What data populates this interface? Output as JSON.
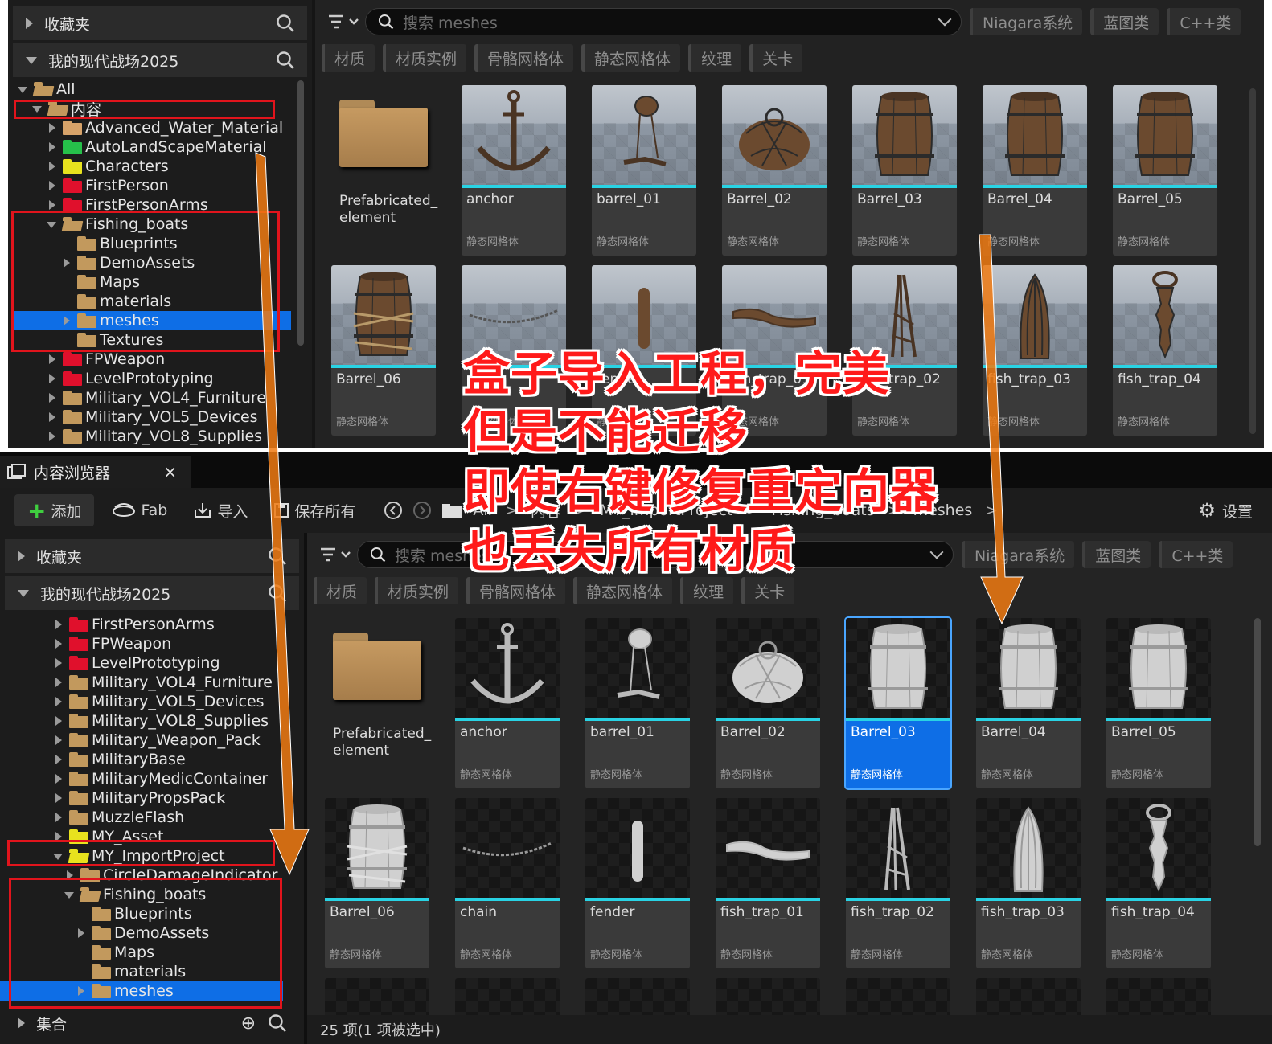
{
  "top": {
    "favorites_label": "收藏夹",
    "project_label": "我的现代战场2025",
    "tree": [
      {
        "label": "All",
        "arrow": "d",
        "color": "#c2995d",
        "indent": 0,
        "open": true
      },
      {
        "label": "内容",
        "arrow": "d",
        "color": "#c2995d",
        "indent": 1,
        "open": true
      },
      {
        "label": "Advanced_Water_Material",
        "arrow": "r",
        "color": "#d7a36a",
        "indent": 2
      },
      {
        "label": "AutoLandScapeMaterial",
        "arrow": "r",
        "color": "#26c04a",
        "indent": 2
      },
      {
        "label": "Characters",
        "arrow": "r",
        "color": "#e8e21e",
        "indent": 2
      },
      {
        "label": "FirstPerson",
        "arrow": "r",
        "color": "#e0102c",
        "indent": 2
      },
      {
        "label": "FirstPersonArms",
        "arrow": "r",
        "color": "#e0102c",
        "indent": 2
      },
      {
        "label": "Fishing_boats",
        "arrow": "d",
        "color": "#c2995d",
        "indent": 2,
        "open": true
      },
      {
        "label": "Blueprints",
        "arrow": "",
        "color": "#c2995d",
        "indent": 3
      },
      {
        "label": "DemoAssets",
        "arrow": "r",
        "color": "#c2995d",
        "indent": 3
      },
      {
        "label": "Maps",
        "arrow": "",
        "color": "#c2995d",
        "indent": 3
      },
      {
        "label": "materials",
        "arrow": "",
        "color": "#c2995d",
        "indent": 3
      },
      {
        "label": "meshes",
        "arrow": "r",
        "color": "#c2995d",
        "indent": 3,
        "selected": true
      },
      {
        "label": "Textures",
        "arrow": "",
        "color": "#c2995d",
        "indent": 3
      },
      {
        "label": "FPWeapon",
        "arrow": "r",
        "color": "#e0102c",
        "indent": 2
      },
      {
        "label": "LevelPrototyping",
        "arrow": "r",
        "color": "#e0102c",
        "indent": 2
      },
      {
        "label": "Military_VOL4_Furniture",
        "arrow": "r",
        "color": "#c2995d",
        "indent": 2
      },
      {
        "label": "Military_VOL5_Devices",
        "arrow": "r",
        "color": "#c2995d",
        "indent": 2
      },
      {
        "label": "Military_VOL8_Supplies",
        "arrow": "r",
        "color": "#c2995d",
        "indent": 2
      }
    ],
    "search_placeholder": "搜索 meshes",
    "pills": [
      "Niagara系统",
      "蓝图类",
      "C++类"
    ],
    "chips": [
      "材质",
      "材质实例",
      "骨骼网格体",
      "静态网格体",
      "纹理",
      "关卡"
    ]
  },
  "bottom": {
    "tab_title": "内容浏览器",
    "tab_close": "×",
    "toolbar": {
      "add": "添加",
      "fab": "Fab",
      "import": "导入",
      "save_all": "保存所有",
      "settings": "设置"
    },
    "breadcrumb": [
      "All",
      "内容",
      "MY_ImportProject",
      "Fishing_boats",
      "meshes"
    ],
    "favorites_label": "收藏夹",
    "project_label": "我的现代战场2025",
    "collections_label": "集合",
    "tree": [
      {
        "label": "FirstPersonArms",
        "arrow": "r",
        "color": "#e0102c",
        "indent": 2
      },
      {
        "label": "FPWeapon",
        "arrow": "r",
        "color": "#e0102c",
        "indent": 2
      },
      {
        "label": "LevelPrototyping",
        "arrow": "r",
        "color": "#e0102c",
        "indent": 2
      },
      {
        "label": "Military_VOL4_Furniture",
        "arrow": "r",
        "color": "#c2995d",
        "indent": 2
      },
      {
        "label": "Military_VOL5_Devices",
        "arrow": "r",
        "color": "#c2995d",
        "indent": 2
      },
      {
        "label": "Military_VOL8_Supplies",
        "arrow": "r",
        "color": "#c2995d",
        "indent": 2
      },
      {
        "label": "Military_Weapon_Pack",
        "arrow": "r",
        "color": "#c2995d",
        "indent": 2
      },
      {
        "label": "MilitaryBase",
        "arrow": "r",
        "color": "#c2995d",
        "indent": 2
      },
      {
        "label": "MilitaryMedicContainer",
        "arrow": "r",
        "color": "#c2995d",
        "indent": 2
      },
      {
        "label": "MilitaryPropsPack",
        "arrow": "r",
        "color": "#c2995d",
        "indent": 2
      },
      {
        "label": "MuzzleFlash",
        "arrow": "r",
        "color": "#c2995d",
        "indent": 2
      },
      {
        "label": "MY_Asset",
        "arrow": "r",
        "color": "#e8e21e",
        "indent": 2
      },
      {
        "label": "MY_ImportProject",
        "arrow": "d",
        "color": "#e8e21e",
        "indent": 2,
        "open": true
      },
      {
        "label": "CircleDamageIndicator",
        "arrow": "r",
        "color": "#c2995d",
        "indent": 3
      },
      {
        "label": "Fishing_boats",
        "arrow": "d",
        "color": "#c2995d",
        "indent": 3,
        "open": true
      },
      {
        "label": "Blueprints",
        "arrow": "",
        "color": "#c2995d",
        "indent": 4
      },
      {
        "label": "DemoAssets",
        "arrow": "r",
        "color": "#c2995d",
        "indent": 4
      },
      {
        "label": "Maps",
        "arrow": "",
        "color": "#c2995d",
        "indent": 4
      },
      {
        "label": "materials",
        "arrow": "",
        "color": "#c2995d",
        "indent": 4
      },
      {
        "label": "meshes",
        "arrow": "r",
        "color": "#c2995d",
        "indent": 4,
        "selected": true
      }
    ],
    "search_placeholder": "搜索 meshes",
    "pills": [
      "Niagara系统",
      "蓝图类",
      "C++类"
    ],
    "chips": [
      "材质",
      "材质实例",
      "骨骼网格体",
      "静态网格体",
      "纹理",
      "关卡"
    ],
    "status": "25 项(1 项被选中)"
  },
  "folder": {
    "name": "Prefabricated_ element"
  },
  "assets": [
    {
      "name": "anchor",
      "shape": "anchor"
    },
    {
      "name": "barrel_01",
      "shape": "barrel_hang"
    },
    {
      "name": "Barrel_02",
      "shape": "net"
    },
    {
      "name": "Barrel_03",
      "shape": "barrel",
      "selected_bottom": true
    },
    {
      "name": "Barrel_04",
      "shape": "barrel"
    },
    {
      "name": "Barrel_05",
      "shape": "barrel"
    },
    {
      "name": "Barrel_06",
      "shape": "barrel_rope"
    },
    {
      "name": "chain",
      "shape": "chain"
    },
    {
      "name": "fender",
      "shape": "fender"
    },
    {
      "name": "fish_trap_01",
      "shape": "log"
    },
    {
      "name": "fish_trap_02",
      "shape": "tripod"
    },
    {
      "name": "fish_trap_03",
      "shape": "cage"
    },
    {
      "name": "fish_trap_04",
      "shape": "trap4"
    }
  ],
  "asset_type": "静态网格体",
  "annotation": {
    "lines": [
      "盒子导入工程，完美",
      "但是不能迁移",
      "即使右键修复重定向器",
      "也丢失所有材质"
    ],
    "colors": {
      "text": "#ff1a1a",
      "outline": "#ffffff",
      "box": "#e1141c",
      "arrow": "#f07a12"
    }
  }
}
